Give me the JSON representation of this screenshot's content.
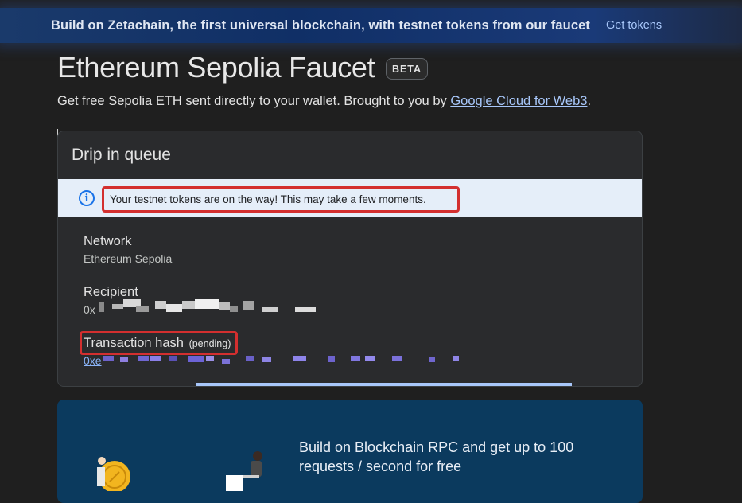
{
  "banner": {
    "text": "Build on Zetachain, the first universal blockchain, with testnet tokens from our faucet",
    "link": "Get tokens"
  },
  "header": {
    "title": "Ethereum Sepolia Faucet",
    "badge": "BETA",
    "subtitle_prefix": "Get free Sepolia ETH sent directly to your wallet. Brought to you by ",
    "subtitle_link": "Google Cloud for Web3",
    "subtitle_suffix": "."
  },
  "queue_card": {
    "title": "Drip in queue",
    "info_message": "Your testnet tokens are on the way! This may take a few moments.",
    "info_icon": "info-icon",
    "network": {
      "label": "Network",
      "value": "Ethereum Sepolia"
    },
    "recipient": {
      "label": "Recipient",
      "value_prefix": "0x"
    },
    "transaction": {
      "label": "Transaction hash",
      "status": "(pending)",
      "value_prefix": "0xe"
    }
  },
  "promo": {
    "text": "Build on Blockchain RPC and get up to 100 requests / second for free"
  },
  "colors": {
    "background": "#1f1f1f",
    "card": "#2a2b2d",
    "link": "#a8c7fa",
    "highlight": "#d32f2f",
    "info_strip": "#e5eef9",
    "promo": "#0b3a5e"
  }
}
